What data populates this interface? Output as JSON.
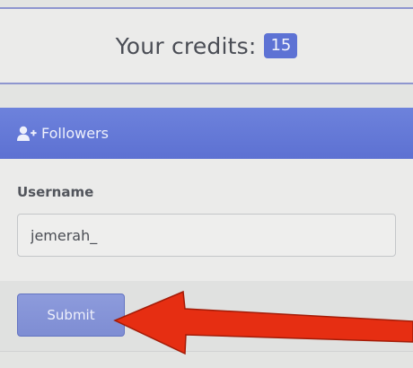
{
  "credits": {
    "label": "Your credits:",
    "value": "15"
  },
  "panel": {
    "title": "Followers",
    "icon": "user-plus-icon"
  },
  "form": {
    "username_label": "Username",
    "username_value": "jemerah_",
    "submit_label": "Submit"
  },
  "colors": {
    "accent": "#5d72d4",
    "annotation_arrow": "#e62e12"
  }
}
